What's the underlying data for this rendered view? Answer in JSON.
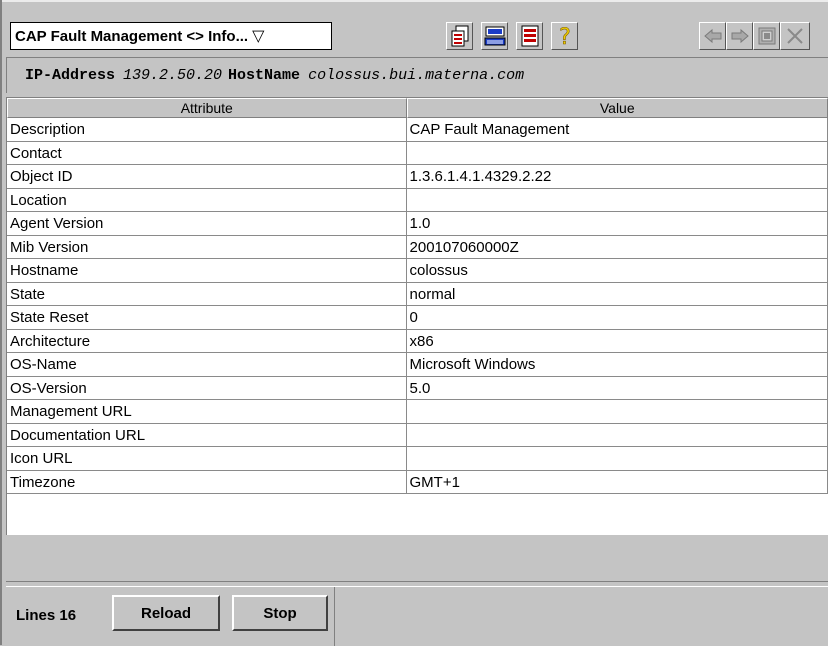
{
  "toolbar": {
    "view_select_value": "CAP Fault Management <> Info...",
    "view_select_arrow": "▽",
    "buttons": [
      {
        "icon": "copy-icon"
      },
      {
        "icon": "keyboard-icon"
      },
      {
        "icon": "list-icon"
      },
      {
        "icon": "help-icon",
        "label": "?"
      },
      {
        "icon": "back-arrow-icon"
      },
      {
        "icon": "forward-arrow-icon"
      },
      {
        "icon": "detach-icon"
      },
      {
        "icon": "close-icon"
      }
    ]
  },
  "host": {
    "ip_label": "IP-Address",
    "ip_value": "139.2.50.20",
    "hostname_label": "HostName",
    "hostname_value": "colossus.bui.materna.com"
  },
  "table": {
    "columns": [
      "Attribute",
      "Value"
    ],
    "rows": [
      [
        "Description",
        "CAP Fault Management"
      ],
      [
        "Contact",
        ""
      ],
      [
        "Object ID",
        "1.3.6.1.4.1.4329.2.22"
      ],
      [
        "Location",
        ""
      ],
      [
        "Agent Version",
        "1.0"
      ],
      [
        "Mib Version",
        "200107060000Z"
      ],
      [
        "Hostname",
        "colossus"
      ],
      [
        "State",
        "normal"
      ],
      [
        "State Reset",
        "0"
      ],
      [
        "Architecture",
        "x86"
      ],
      [
        "OS-Name",
        "Microsoft Windows"
      ],
      [
        "OS-Version",
        "5.0"
      ],
      [
        "Management URL",
        ""
      ],
      [
        "Documentation URL",
        ""
      ],
      [
        "Icon URL",
        ""
      ],
      [
        "Timezone",
        "GMT+1"
      ]
    ]
  },
  "status": {
    "lines_label": "Lines",
    "lines_count": "16",
    "reload_label": "Reload",
    "stop_label": "Stop"
  },
  "colors": {
    "panel_bg": "#c4c4c4",
    "table_bg": "#ffffff"
  }
}
